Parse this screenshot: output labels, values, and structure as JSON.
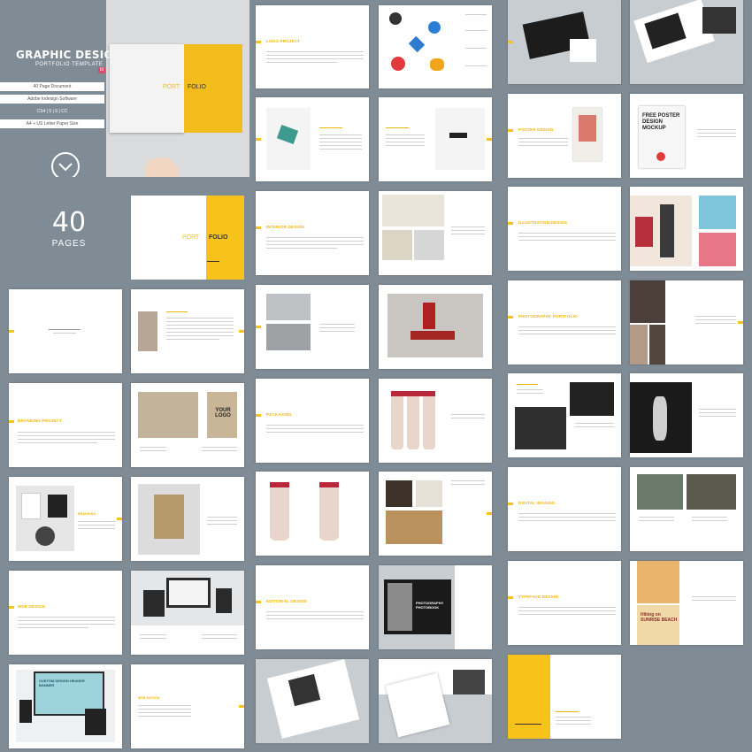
{
  "hero": {
    "title": "GRAPHIC DESIGN",
    "subtitle": "PORTFOLIO TEMPLATE",
    "badge": "Id",
    "features": [
      "40 Page Document",
      "Adobe Indesign Software",
      "CS4 | 5 | 6 | CC",
      "A4 + US Letter Paper Size"
    ],
    "cover_left": "PORT",
    "cover_right": "FOLIO"
  },
  "count": {
    "number": "40",
    "label": "PAGES"
  },
  "cover2": {
    "left": "PORT",
    "right": "FOLIO"
  },
  "sections": {
    "logo": "LOGO PROJECT",
    "interior": "INTERIOR DESIGN",
    "packaging": "PACKAGING",
    "editorial": "EDITORIAL DESIGN",
    "poster": "POSTER DESIGN",
    "illustration": "ILLUSTRATION DESIGN",
    "photography": "PHOTOGRAPHY PORTFOLIO",
    "digital": "DIGITAL IMAGING",
    "typeface": "TYPEFACE DESIGN",
    "branding": "BRANDING PROJECT",
    "web": "WEB DESIGN"
  },
  "mockup": {
    "your_logo": "YOUR LOGO",
    "photobook": "PHOTOGRAPHY PHOTOBOOK",
    "poster_text": "FREE POSTER DESIGN MOCKUP",
    "summer": "Hiking on SUNRISE BEACH",
    "web_banner": "CUSTOM DESIGN HEADER BANNER"
  }
}
